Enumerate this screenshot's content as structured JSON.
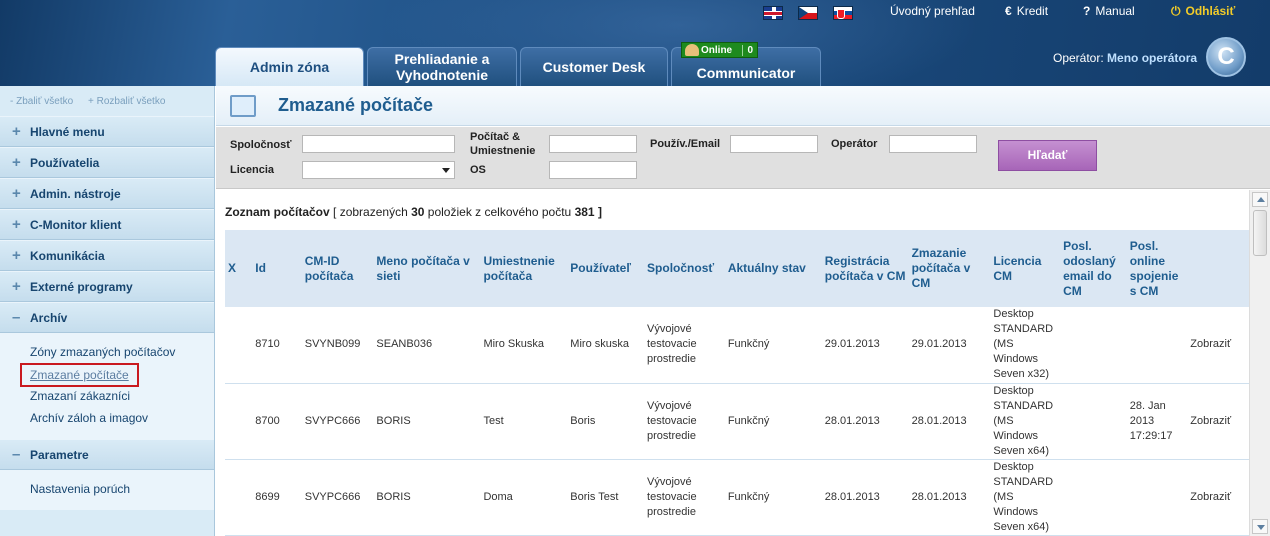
{
  "header": {
    "top_links": {
      "overview": "Úvodný prehľad",
      "credit_icon": "€",
      "credit": "Kredit",
      "manual_icon": "?",
      "manual": "Manual",
      "logout_icon": "⏻",
      "logout": "Odhlásiť"
    },
    "flags": [
      "uk-flag-icon",
      "cz-flag-icon",
      "sk-flag-icon"
    ],
    "tabs": [
      {
        "label": "Admin zóna",
        "active": true
      },
      {
        "label": "Prehliadanie a Vyhodnotenie",
        "active": false
      },
      {
        "label": "Customer Desk",
        "active": false
      },
      {
        "label": "Communicator",
        "active": false
      }
    ],
    "online_badge": {
      "label": "Online",
      "count": "0"
    },
    "operator": {
      "label": "Operátor:",
      "name": "Meno operátora"
    },
    "logo_letter": "C"
  },
  "sidebar": {
    "collapse_all": "- Zbaliť všetko",
    "expand_all": "+ Rozbaliť všetko",
    "menus": [
      {
        "sign": "+",
        "label": "Hlavné menu"
      },
      {
        "sign": "+",
        "label": "Používatelia"
      },
      {
        "sign": "+",
        "label": "Admin. nástroje"
      },
      {
        "sign": "+",
        "label": "C-Monitor klient"
      },
      {
        "sign": "+",
        "label": "Komunikácia"
      },
      {
        "sign": "+",
        "label": "Externé programy"
      },
      {
        "sign": "–",
        "label": "Archív"
      },
      {
        "sign": "–",
        "label": "Parametre"
      }
    ],
    "archiv_items": [
      "Zóny zmazaných počítačov",
      "Zmazané počítače",
      "Zmazaní zákazníci",
      "Archív záloh a imagov"
    ],
    "parametre_items": [
      "Nastavenia porúch"
    ]
  },
  "page": {
    "title": "Zmazané počítače"
  },
  "filter": {
    "company_label": "Spoločnosť",
    "pc_location_label_1": "Počítač &",
    "pc_location_label_2": "Umiestnenie",
    "user_email_label": "Použív./Email",
    "operator_label": "Operátor",
    "license_label": "Licencia",
    "os_label": "OS",
    "search_button": "Hľadať"
  },
  "list": {
    "summary_title": "Zoznam počítačov",
    "summary_open": "[ zobrazených",
    "shown": "30",
    "summary_mid": "položiek z celkového počtu",
    "total": "381",
    "summary_close": "]",
    "columns": [
      "X",
      "Id",
      "CM-ID počítača",
      "Meno počítača v sieti",
      "Umiestnenie počítača",
      "Používateľ",
      "Spoločnosť",
      "Aktuálny stav",
      "Registrácia počítača v CM",
      "Zmazanie počítača v CM",
      "Licencia CM",
      "Posl. odoslaný email do CM",
      "Posl. online spojenie s CM",
      ""
    ],
    "rows": [
      {
        "x": "",
        "id": "8710",
        "cmid": "SVYNB099",
        "name": "SEANB036",
        "location": "Miro Skuska",
        "user": "Miro skuska",
        "company": "Vývojové testovacie prostredie",
        "status": "Funkčný",
        "registered": "29.01.2013",
        "deleted": "29.01.2013",
        "license": "Desktop STANDARD (MS Windows Seven x32)",
        "last_email": "",
        "last_online": "",
        "action": "Zobraziť"
      },
      {
        "x": "",
        "id": "8700",
        "cmid": "SVYPC666",
        "name": "BORIS",
        "location": "Test",
        "user": "Boris",
        "company": "Vývojové testovacie prostredie",
        "status": "Funkčný",
        "registered": "28.01.2013",
        "deleted": "28.01.2013",
        "license": "Desktop STANDARD (MS Windows Seven x64)",
        "last_email": "",
        "last_online": "28. Jan 2013 17:29:17",
        "action": "Zobraziť"
      },
      {
        "x": "",
        "id": "8699",
        "cmid": "SVYPC666",
        "name": "BORIS",
        "location": "Doma",
        "user": "Boris Test",
        "company": "Vývojové testovacie prostredie",
        "status": "Funkčný",
        "registered": "28.01.2013",
        "deleted": "28.01.2013",
        "license": "Desktop STANDARD (MS Windows Seven x64)",
        "last_email": "",
        "last_online": "",
        "action": "Zobraziť"
      }
    ]
  }
}
